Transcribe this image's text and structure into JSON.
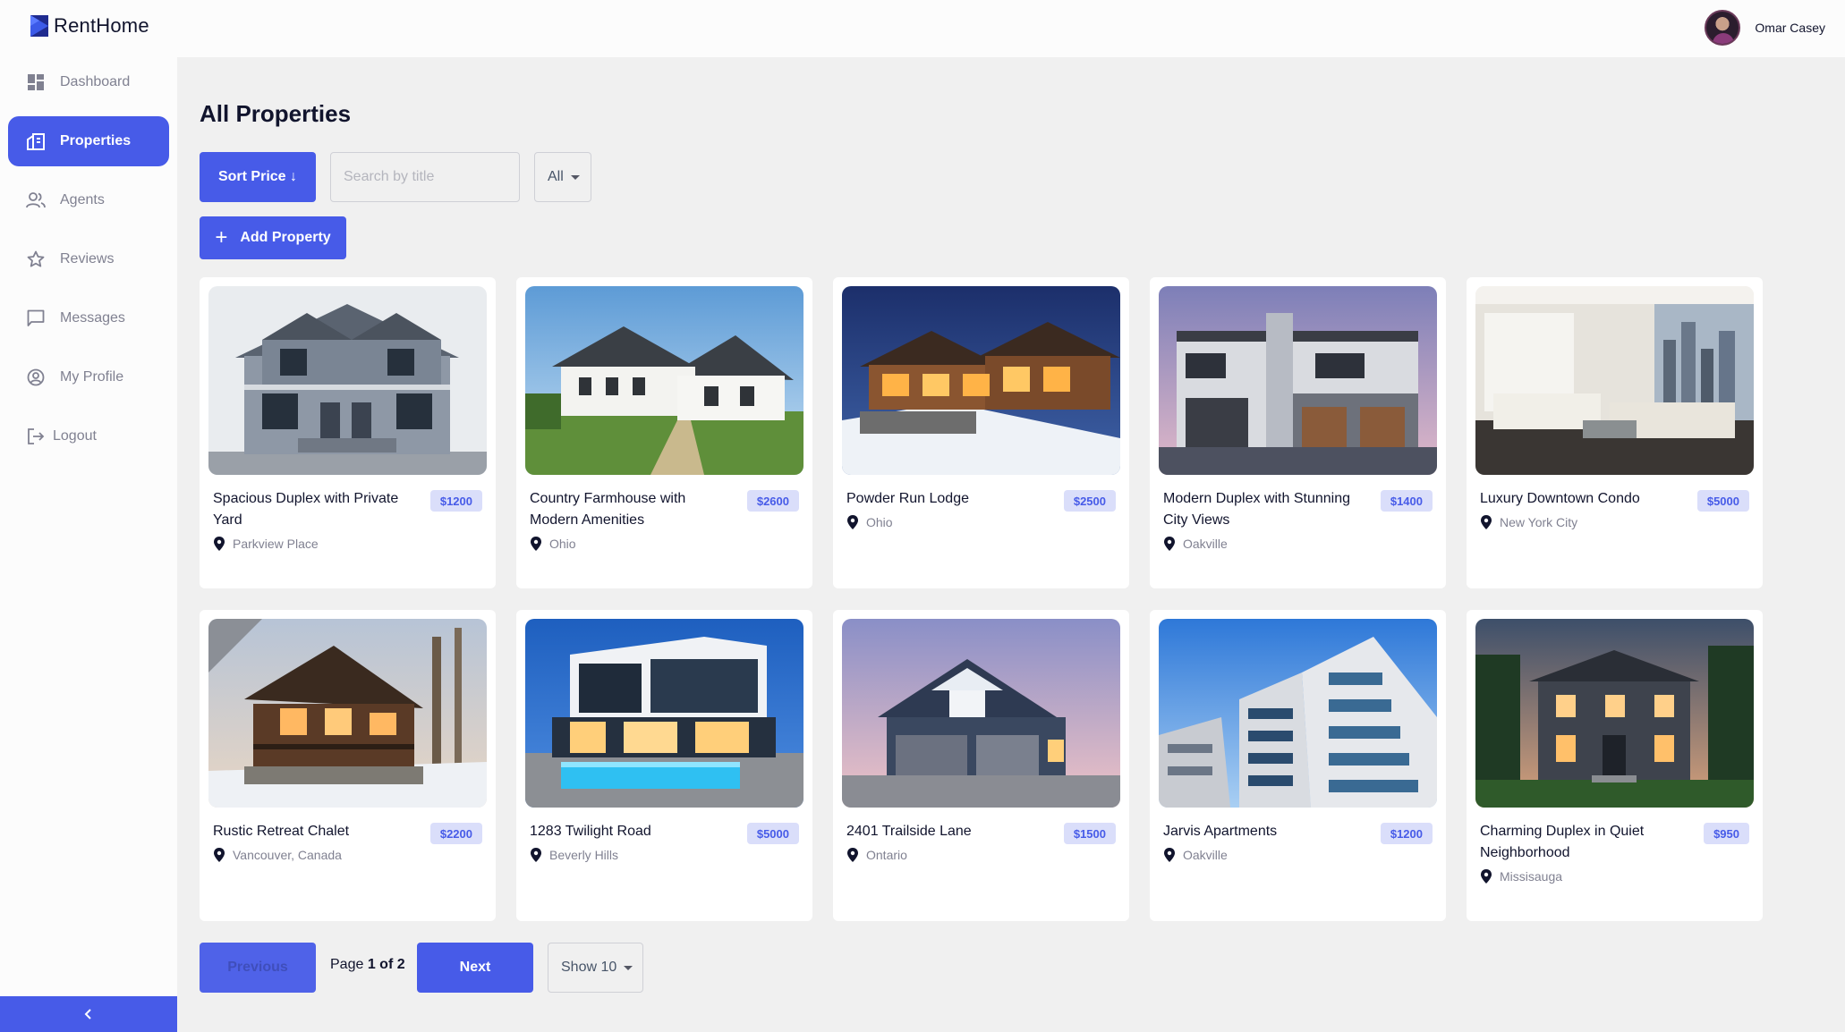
{
  "app": {
    "name": "RentHome"
  },
  "sidebar": {
    "items": [
      {
        "label": "Dashboard",
        "icon": "dashboard-icon",
        "active": false
      },
      {
        "label": "Properties",
        "icon": "properties-icon",
        "active": true
      },
      {
        "label": "Agents",
        "icon": "agents-icon",
        "active": false
      },
      {
        "label": "Reviews",
        "icon": "star-icon",
        "active": false
      },
      {
        "label": "Messages",
        "icon": "chat-icon",
        "active": false
      },
      {
        "label": "My Profile",
        "icon": "profile-icon",
        "active": false
      },
      {
        "label": "Logout",
        "icon": "logout-icon",
        "active": false
      }
    ],
    "collapse_icon": "chevron-left-icon"
  },
  "header": {
    "user_name": "Omar Casey"
  },
  "main": {
    "title": "All Properties",
    "sort_label": "Sort Price ↓",
    "search_placeholder": "Search by title",
    "filter_value": "All",
    "add_label": "Add Property"
  },
  "properties": [
    {
      "title": "Spacious Duplex with Private Yard",
      "price": "$1200",
      "location": "Parkview Place"
    },
    {
      "title": "Country Farmhouse with Modern Amenities",
      "price": "$2600",
      "location": "Ohio"
    },
    {
      "title": "Powder Run Lodge",
      "price": "$2500",
      "location": "Ohio"
    },
    {
      "title": "Modern Duplex with Stunning City Views",
      "price": "$1400",
      "location": "Oakville"
    },
    {
      "title": "Luxury Downtown Condo",
      "price": "$5000",
      "location": "New York City"
    },
    {
      "title": "Rustic Retreat Chalet",
      "price": "$2200",
      "location": "Vancouver, Canada"
    },
    {
      "title": "1283 Twilight Road",
      "price": "$5000",
      "location": "Beverly Hills"
    },
    {
      "title": "2401 Trailside Lane",
      "price": "$1500",
      "location": "Ontario"
    },
    {
      "title": "Jarvis Apartments",
      "price": "$1200",
      "location": "Oakville"
    },
    {
      "title": "Charming Duplex in Quiet Neighborhood",
      "price": "$950",
      "location": "Missisauga"
    }
  ],
  "pagination": {
    "previous_label": "Previous",
    "page_prefix": "Page",
    "page_current": "1 of 2",
    "next_label": "Next",
    "show_label": "Show 10"
  },
  "colors": {
    "accent": "#475be8",
    "background": "#f0f0f0",
    "price_badge": "#dadefa"
  }
}
